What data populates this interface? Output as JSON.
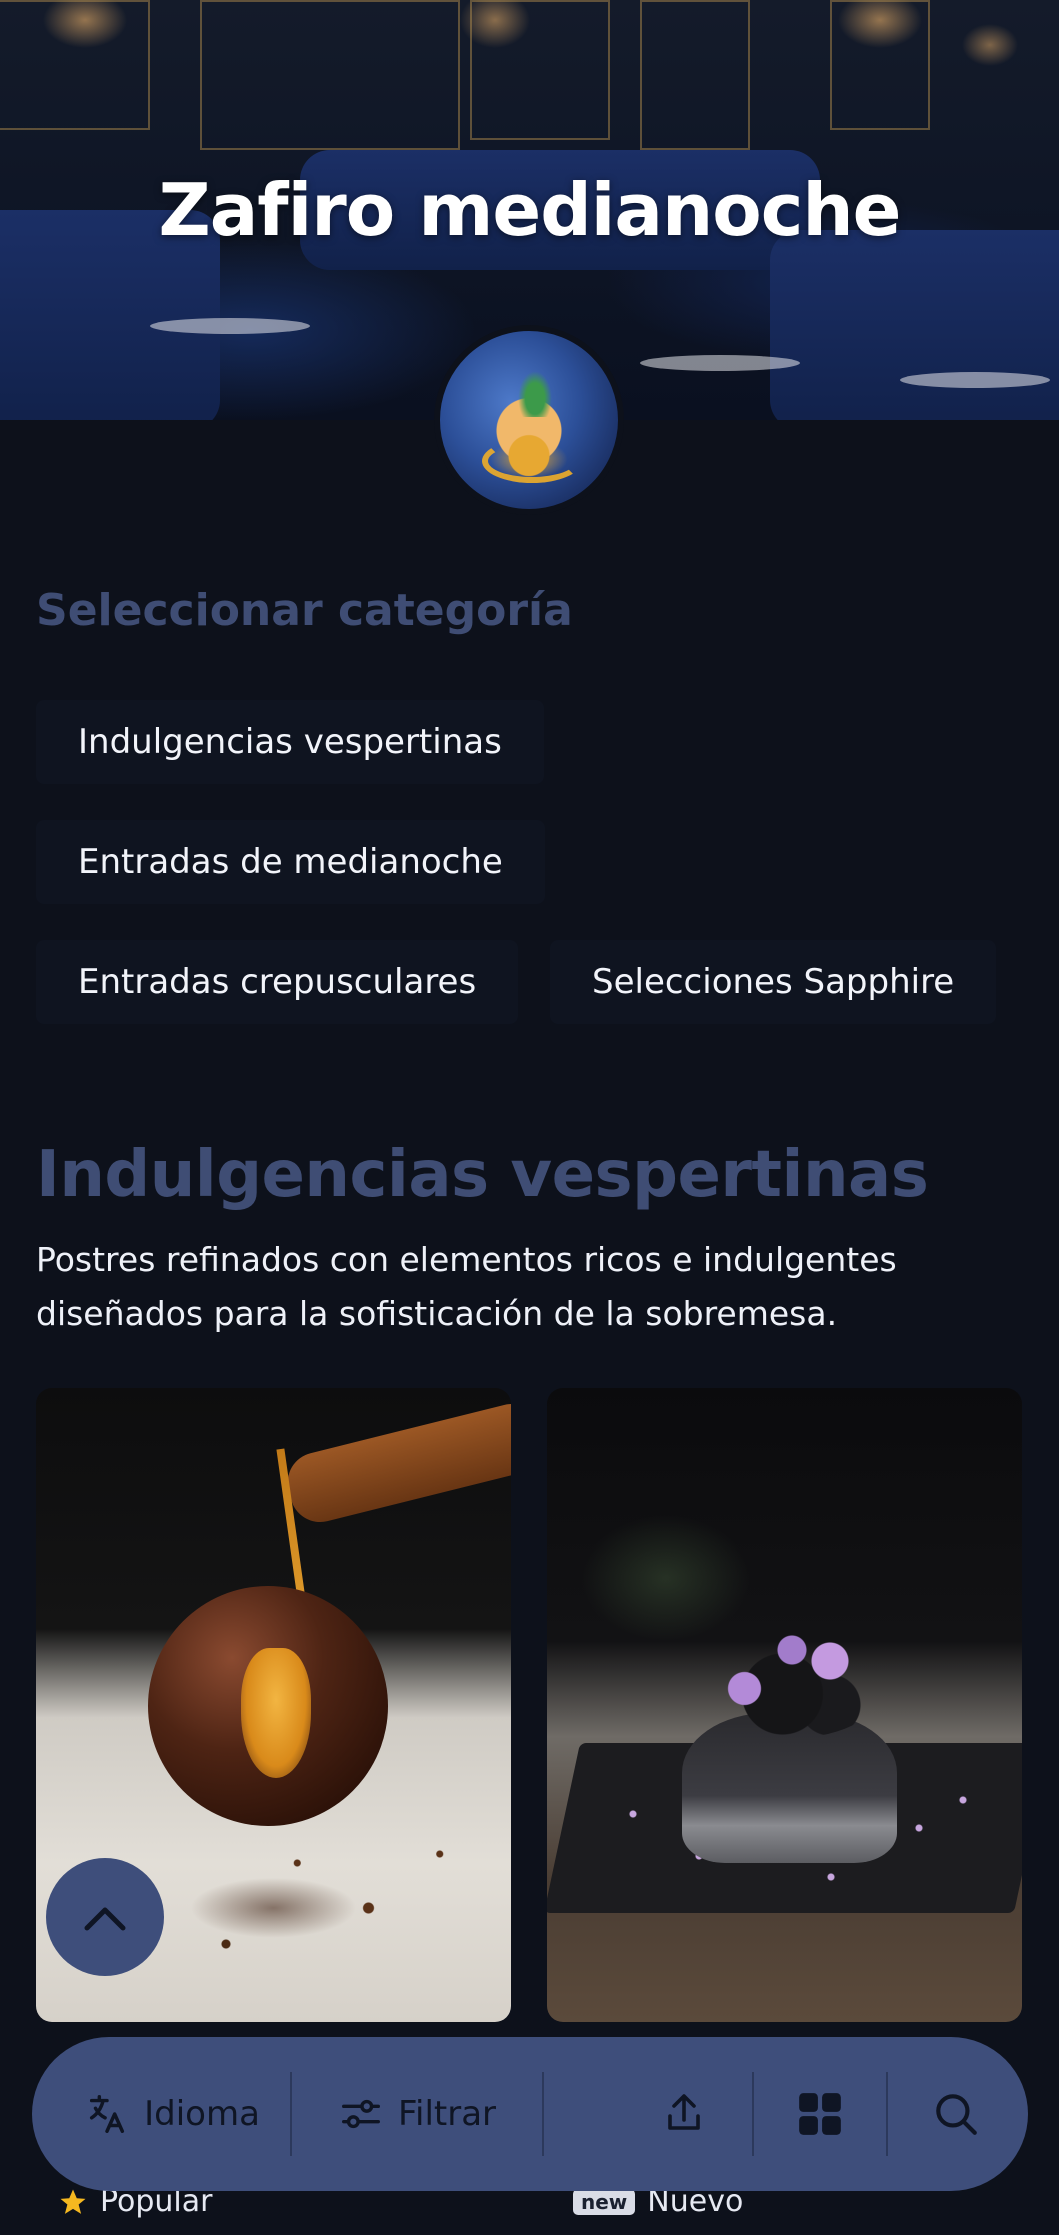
{
  "header": {
    "title": "Zafiro medianoche"
  },
  "categories": {
    "title": "Seleccionar categoría",
    "items": [
      {
        "label": "Indulgencias vespertinas"
      },
      {
        "label": "Entradas de medianoche"
      },
      {
        "label": "Entradas crepusculares"
      },
      {
        "label": "Selecciones Sapphire"
      }
    ]
  },
  "section": {
    "title": "Indulgencias vespertinas",
    "description": "Postres refinados con elementos ricos e indulgentes diseñados para la sofisticación de la sobremesa."
  },
  "toolbar": {
    "language_label": "Idioma",
    "filter_label": "Filtrar"
  },
  "legend": {
    "popular_label": "Popular",
    "new_badge": "new",
    "new_label": "Nuevo"
  },
  "colors": {
    "background": "#0d111b",
    "accent": "#3e4e7b",
    "heading": "#3f4d74",
    "star": "#f5b820"
  }
}
